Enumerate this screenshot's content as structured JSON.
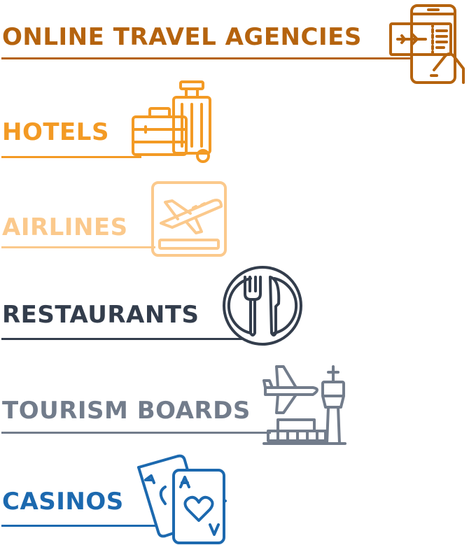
{
  "categories": [
    {
      "id": "ota",
      "label": "ONLINE TRAVEL AGENCIES",
      "color": "#B5630E",
      "icon": "mobile-ticket-icon"
    },
    {
      "id": "hotels",
      "label": "HOTELS",
      "color": "#F39A24",
      "icon": "luggage-icon"
    },
    {
      "id": "airlines",
      "label": "AIRLINES",
      "color": "#FBC98C",
      "icon": "airplane-departure-icon"
    },
    {
      "id": "restaurants",
      "label": "RESTAURANTS",
      "color": "#333D4C",
      "icon": "plate-cutlery-icon"
    },
    {
      "id": "tourism",
      "label": "TOURISM BOARDS",
      "color": "#727C8B",
      "icon": "airport-tower-icon"
    },
    {
      "id": "casinos",
      "label": "CASINOS",
      "color": "#1C69AF",
      "icon": "playing-cards-icon"
    }
  ]
}
